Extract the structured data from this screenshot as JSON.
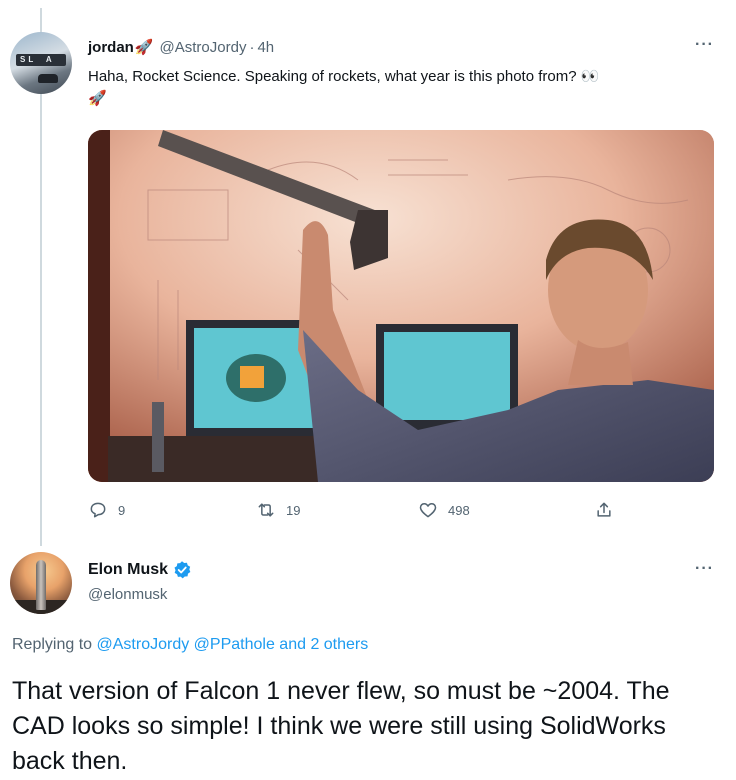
{
  "tweet1": {
    "name": "jordan",
    "name_emoji": "🚀",
    "handle": "@AstroJordy",
    "time": "4h",
    "separator": "·",
    "more": "···",
    "text": "Haha, Rocket Science. Speaking of rockets, what year is this photo from? 👀",
    "text_emoji": "🚀",
    "avatar_text": "SL  A",
    "actions": {
      "reply_count": "9",
      "retweet_count": "19",
      "like_count": "498"
    }
  },
  "tweet2": {
    "name": "Elon Musk",
    "handle": "@elonmusk",
    "more": "···",
    "replying_prefix": "Replying to",
    "replying_mentions": "@AstroJordy @PPathole",
    "replying_suffix": "and 2 others",
    "text": "That version of Falcon 1 never flew, so must be ~2004. The CAD looks so simple! I think we were still using SolidWorks back then."
  },
  "colors": {
    "link": "#1d9bf0",
    "muted": "#536471",
    "verified": "#1d9bf0"
  },
  "icons": [
    "reply-icon",
    "retweet-icon",
    "like-icon",
    "share-icon",
    "verified-badge-icon",
    "more-icon"
  ]
}
